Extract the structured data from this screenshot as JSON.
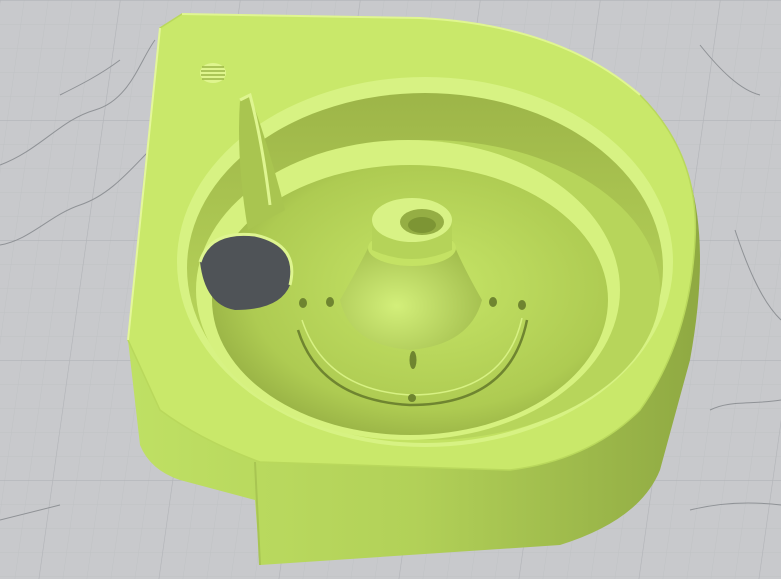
{
  "viewport": {
    "background_color": "#c8c9cc",
    "grid_major_color": "#b3b5b9",
    "grid_minor_color": "#bfc1c4",
    "contour_color": "#8f9296"
  },
  "model": {
    "description_icon": "3d-part-icon",
    "base_color": "#c9e86a",
    "light_color": "#dff58e",
    "mid_color": "#b4d35a",
    "shadow_color": "#96b043",
    "deep_shadow_color": "#7f9836",
    "hole_color": "#4f5357",
    "hole_inner_color": "#6a6e72"
  }
}
